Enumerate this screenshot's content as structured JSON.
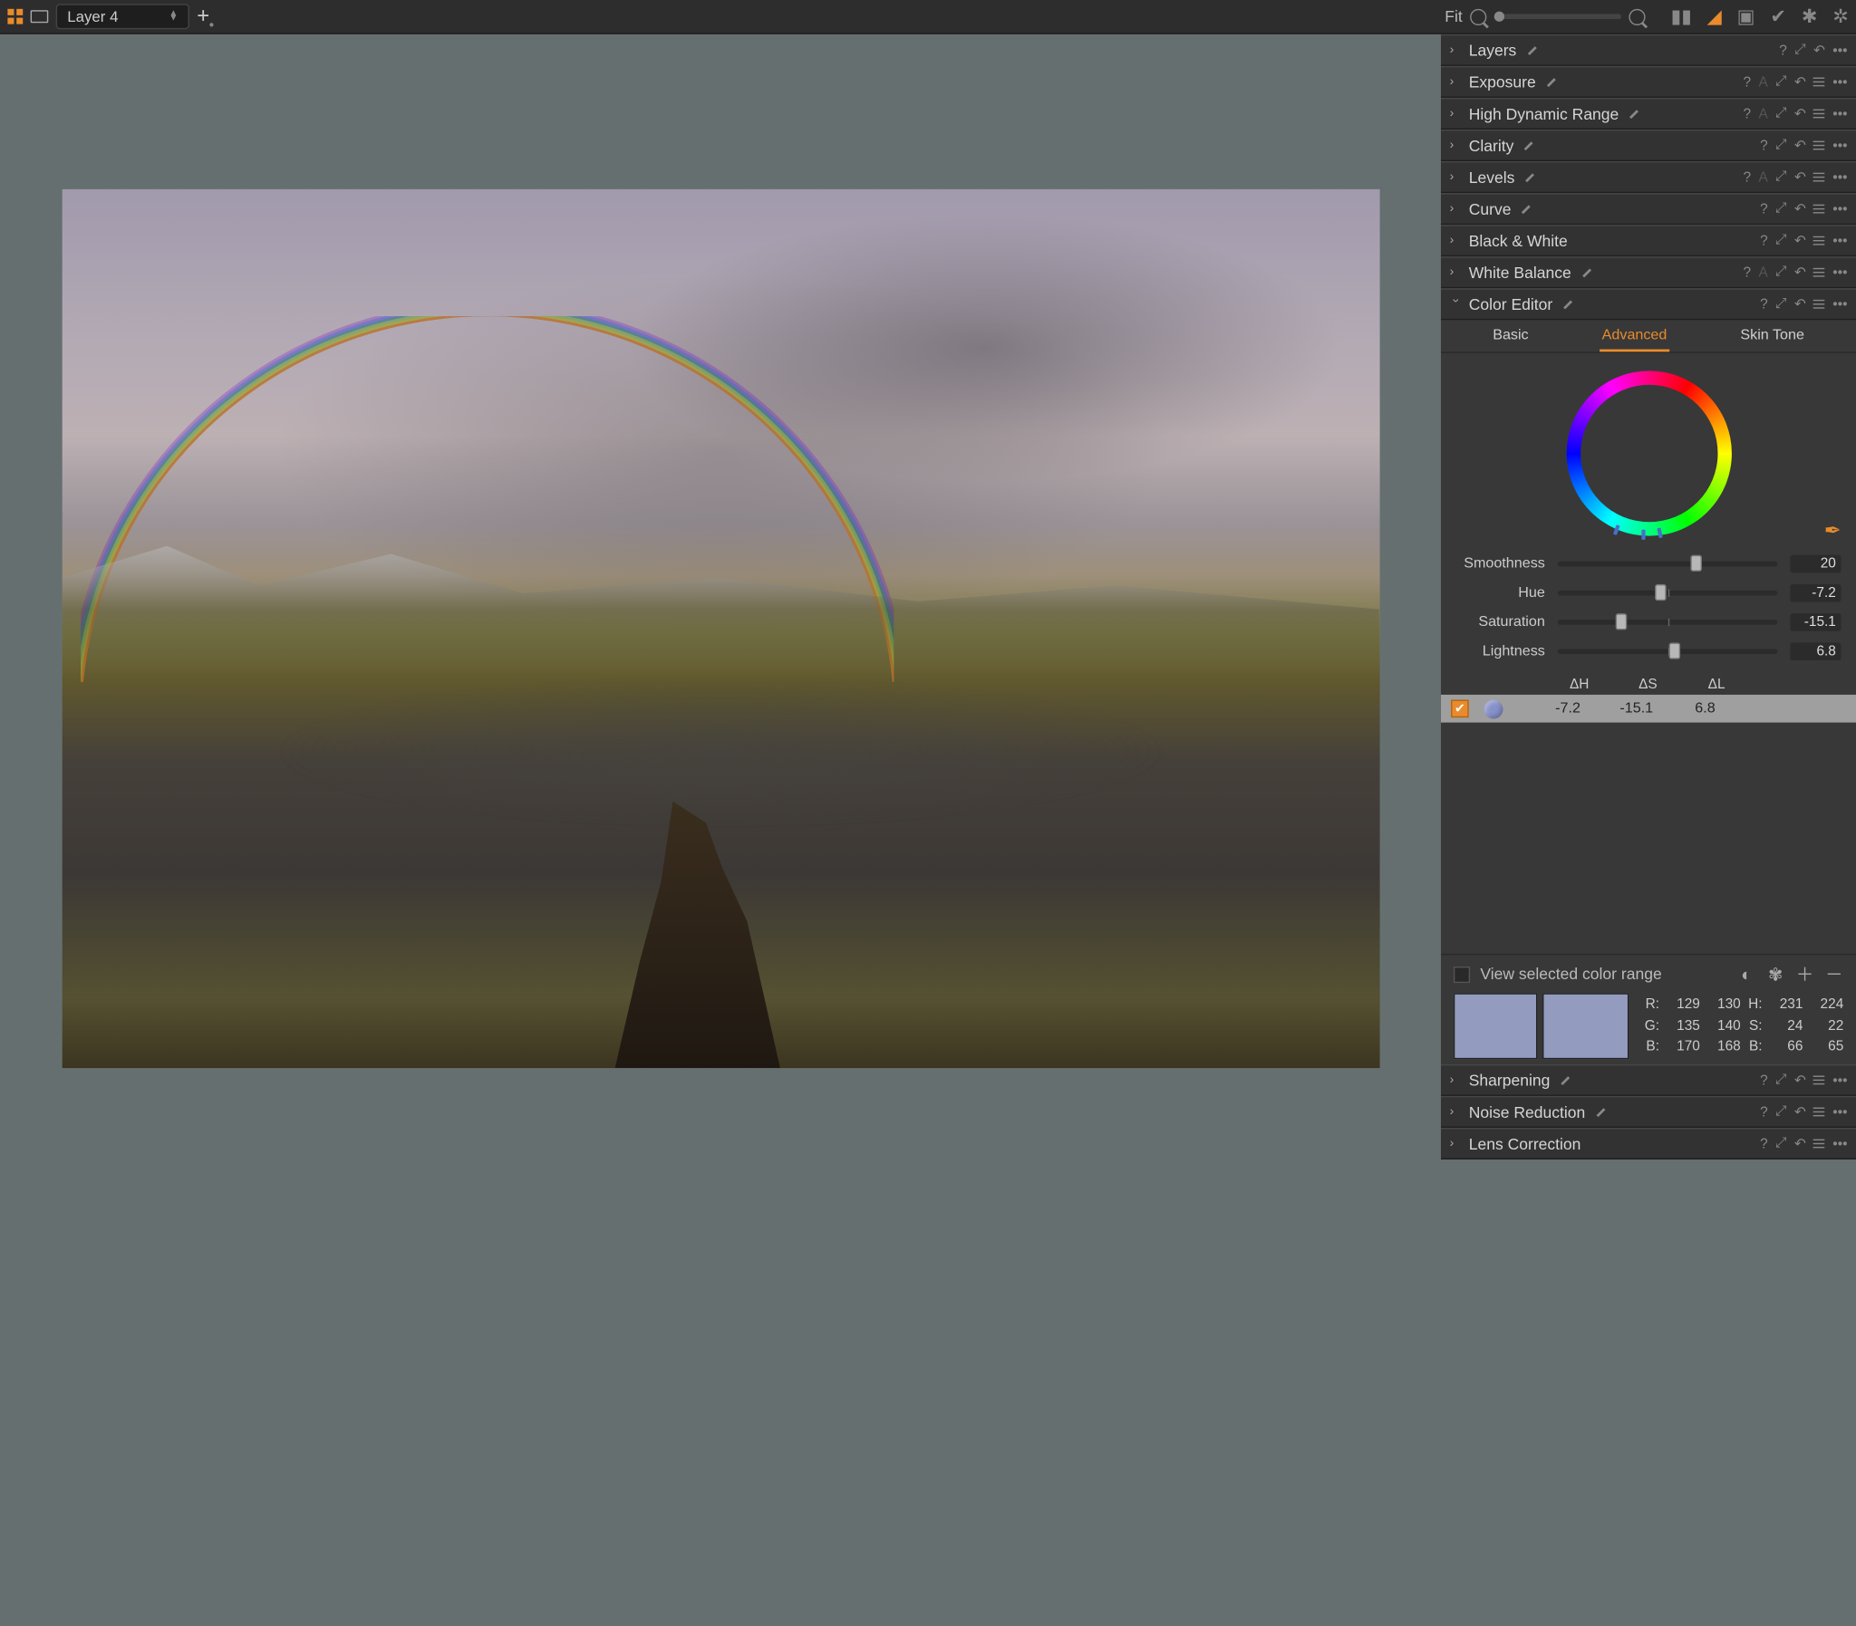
{
  "topbar": {
    "layer_label": "Layer 4",
    "zoom_label": "Fit"
  },
  "panels": {
    "layers": "Layers",
    "exposure": "Exposure",
    "hdr": "High Dynamic Range",
    "clarity": "Clarity",
    "levels": "Levels",
    "curve": "Curve",
    "bw": "Black & White",
    "wb": "White Balance",
    "coloreditor": "Color Editor",
    "sharpening": "Sharpening",
    "noise": "Noise Reduction",
    "lens": "Lens Correction"
  },
  "colorEditor": {
    "tabs": {
      "basic": "Basic",
      "advanced": "Advanced",
      "skin": "Skin Tone"
    },
    "sliders": {
      "smoothness": {
        "label": "Smoothness",
        "value": "20",
        "pos": 63
      },
      "hue": {
        "label": "Hue",
        "value": "-7.2",
        "pos": 47
      },
      "saturation": {
        "label": "Saturation",
        "value": "-15.1",
        "pos": 29
      },
      "lightness": {
        "label": "Lightness",
        "value": "6.8",
        "pos": 53
      }
    },
    "deltaHeader": {
      "dh": "ΔH",
      "ds": "ΔS",
      "dl": "ΔL"
    },
    "row": {
      "dh": "-7.2",
      "ds": "-15.1",
      "dl": "6.8"
    },
    "view_label": "View selected color range",
    "readout": {
      "R": "R:",
      "R1": "129",
      "R2": "130",
      "H": "H:",
      "H1": "231",
      "H2": "224",
      "G": "G:",
      "G1": "135",
      "G2": "140",
      "S": "S:",
      "S1": "24",
      "S2": "22",
      "B": "B:",
      "B1": "170",
      "B2": "168",
      "Br": "B:",
      "Br1": "66",
      "Br2": "65"
    }
  }
}
